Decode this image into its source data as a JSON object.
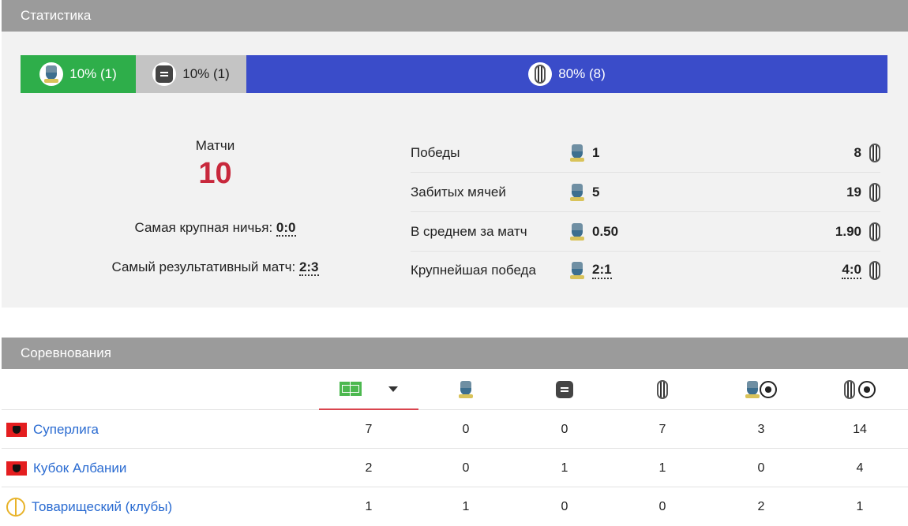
{
  "stats": {
    "header": "Статистика",
    "bar": {
      "win": "10% (1)",
      "draw": "10% (1)",
      "loss": "80% (8)"
    },
    "matches_label": "Матчи",
    "matches_value": "10",
    "biggest_draw_label": "Самая крупная ничья:",
    "biggest_draw_value": "0:0",
    "top_scoring_label": "Самый результативный матч:",
    "top_scoring_value": "2:3",
    "comparisons": [
      {
        "label": "Победы",
        "home": "1",
        "away": "8"
      },
      {
        "label": "Забитых мячей",
        "home": "5",
        "away": "19"
      },
      {
        "label": "В среднем за матч",
        "home": "0.50",
        "away": "1.90"
      },
      {
        "label": "Крупнейшая победа",
        "home": "2:1",
        "away": "4:0"
      }
    ]
  },
  "competitions": {
    "header": "Соревнования",
    "columns": [
      "matches-icon",
      "home-wins-icon",
      "draws-icon",
      "away-wins-icon",
      "home-goals-icon",
      "away-goals-icon"
    ],
    "rows": [
      {
        "flag": "albania-flag-icon",
        "name": "Суперлига",
        "values": [
          "7",
          "0",
          "0",
          "7",
          "3",
          "14"
        ]
      },
      {
        "flag": "albania-flag-icon",
        "name": "Кубок Албании",
        "values": [
          "2",
          "0",
          "1",
          "1",
          "0",
          "4"
        ]
      },
      {
        "flag": "peace-icon",
        "name": "Товарищеский (клубы)",
        "values": [
          "1",
          "1",
          "0",
          "0",
          "2",
          "1"
        ]
      }
    ]
  },
  "colors": {
    "win": "#2eae4a",
    "draw": "#c4c4c4",
    "loss": "#3a4cc9",
    "header_bg": "#9b9b9b",
    "accent_red": "#c8283c",
    "link": "#2a6bd1"
  }
}
